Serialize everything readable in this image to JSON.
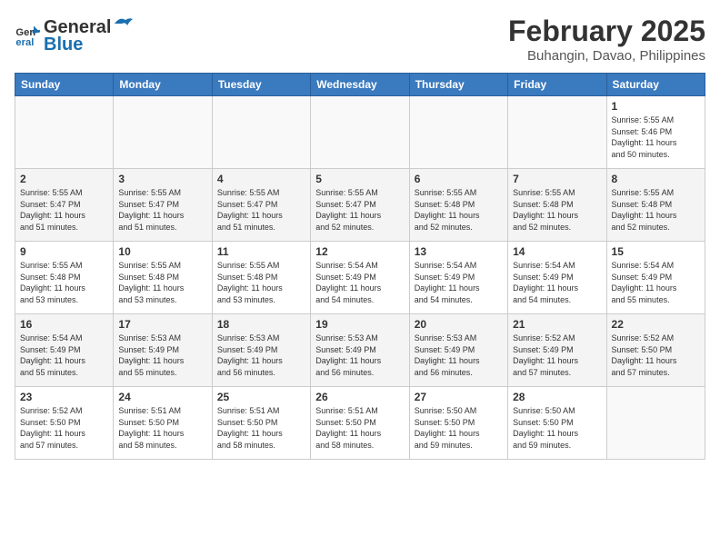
{
  "header": {
    "logo_line1": "General",
    "logo_line2": "Blue",
    "title": "February 2025",
    "subtitle": "Buhangin, Davao, Philippines"
  },
  "weekdays": [
    "Sunday",
    "Monday",
    "Tuesday",
    "Wednesday",
    "Thursday",
    "Friday",
    "Saturday"
  ],
  "weeks": [
    [
      {
        "day": "",
        "info": ""
      },
      {
        "day": "",
        "info": ""
      },
      {
        "day": "",
        "info": ""
      },
      {
        "day": "",
        "info": ""
      },
      {
        "day": "",
        "info": ""
      },
      {
        "day": "",
        "info": ""
      },
      {
        "day": "1",
        "info": "Sunrise: 5:55 AM\nSunset: 5:46 PM\nDaylight: 11 hours\nand 50 minutes."
      }
    ],
    [
      {
        "day": "2",
        "info": "Sunrise: 5:55 AM\nSunset: 5:47 PM\nDaylight: 11 hours\nand 51 minutes."
      },
      {
        "day": "3",
        "info": "Sunrise: 5:55 AM\nSunset: 5:47 PM\nDaylight: 11 hours\nand 51 minutes."
      },
      {
        "day": "4",
        "info": "Sunrise: 5:55 AM\nSunset: 5:47 PM\nDaylight: 11 hours\nand 51 minutes."
      },
      {
        "day": "5",
        "info": "Sunrise: 5:55 AM\nSunset: 5:47 PM\nDaylight: 11 hours\nand 52 minutes."
      },
      {
        "day": "6",
        "info": "Sunrise: 5:55 AM\nSunset: 5:48 PM\nDaylight: 11 hours\nand 52 minutes."
      },
      {
        "day": "7",
        "info": "Sunrise: 5:55 AM\nSunset: 5:48 PM\nDaylight: 11 hours\nand 52 minutes."
      },
      {
        "day": "8",
        "info": "Sunrise: 5:55 AM\nSunset: 5:48 PM\nDaylight: 11 hours\nand 52 minutes."
      }
    ],
    [
      {
        "day": "9",
        "info": "Sunrise: 5:55 AM\nSunset: 5:48 PM\nDaylight: 11 hours\nand 53 minutes."
      },
      {
        "day": "10",
        "info": "Sunrise: 5:55 AM\nSunset: 5:48 PM\nDaylight: 11 hours\nand 53 minutes."
      },
      {
        "day": "11",
        "info": "Sunrise: 5:55 AM\nSunset: 5:48 PM\nDaylight: 11 hours\nand 53 minutes."
      },
      {
        "day": "12",
        "info": "Sunrise: 5:54 AM\nSunset: 5:49 PM\nDaylight: 11 hours\nand 54 minutes."
      },
      {
        "day": "13",
        "info": "Sunrise: 5:54 AM\nSunset: 5:49 PM\nDaylight: 11 hours\nand 54 minutes."
      },
      {
        "day": "14",
        "info": "Sunrise: 5:54 AM\nSunset: 5:49 PM\nDaylight: 11 hours\nand 54 minutes."
      },
      {
        "day": "15",
        "info": "Sunrise: 5:54 AM\nSunset: 5:49 PM\nDaylight: 11 hours\nand 55 minutes."
      }
    ],
    [
      {
        "day": "16",
        "info": "Sunrise: 5:54 AM\nSunset: 5:49 PM\nDaylight: 11 hours\nand 55 minutes."
      },
      {
        "day": "17",
        "info": "Sunrise: 5:53 AM\nSunset: 5:49 PM\nDaylight: 11 hours\nand 55 minutes."
      },
      {
        "day": "18",
        "info": "Sunrise: 5:53 AM\nSunset: 5:49 PM\nDaylight: 11 hours\nand 56 minutes."
      },
      {
        "day": "19",
        "info": "Sunrise: 5:53 AM\nSunset: 5:49 PM\nDaylight: 11 hours\nand 56 minutes."
      },
      {
        "day": "20",
        "info": "Sunrise: 5:53 AM\nSunset: 5:49 PM\nDaylight: 11 hours\nand 56 minutes."
      },
      {
        "day": "21",
        "info": "Sunrise: 5:52 AM\nSunset: 5:49 PM\nDaylight: 11 hours\nand 57 minutes."
      },
      {
        "day": "22",
        "info": "Sunrise: 5:52 AM\nSunset: 5:50 PM\nDaylight: 11 hours\nand 57 minutes."
      }
    ],
    [
      {
        "day": "23",
        "info": "Sunrise: 5:52 AM\nSunset: 5:50 PM\nDaylight: 11 hours\nand 57 minutes."
      },
      {
        "day": "24",
        "info": "Sunrise: 5:51 AM\nSunset: 5:50 PM\nDaylight: 11 hours\nand 58 minutes."
      },
      {
        "day": "25",
        "info": "Sunrise: 5:51 AM\nSunset: 5:50 PM\nDaylight: 11 hours\nand 58 minutes."
      },
      {
        "day": "26",
        "info": "Sunrise: 5:51 AM\nSunset: 5:50 PM\nDaylight: 11 hours\nand 58 minutes."
      },
      {
        "day": "27",
        "info": "Sunrise: 5:50 AM\nSunset: 5:50 PM\nDaylight: 11 hours\nand 59 minutes."
      },
      {
        "day": "28",
        "info": "Sunrise: 5:50 AM\nSunset: 5:50 PM\nDaylight: 11 hours\nand 59 minutes."
      },
      {
        "day": "",
        "info": ""
      }
    ]
  ]
}
